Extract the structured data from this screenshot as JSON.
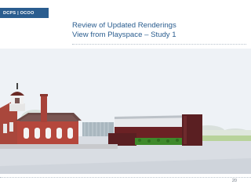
{
  "header": {
    "brand": "DCPS | OCOO"
  },
  "slide": {
    "title_line1": "Review of Updated Renderings",
    "title_line2": "View from Playspace – Study 1",
    "page_number": "20"
  },
  "colors": {
    "brand_blue": "#2a5d8f",
    "sky": "#e8eef3",
    "brick": "#b5473c",
    "dark_brick": "#5a1f22",
    "hedge": "#3f8a2b",
    "pavement": "#d9dde3"
  }
}
